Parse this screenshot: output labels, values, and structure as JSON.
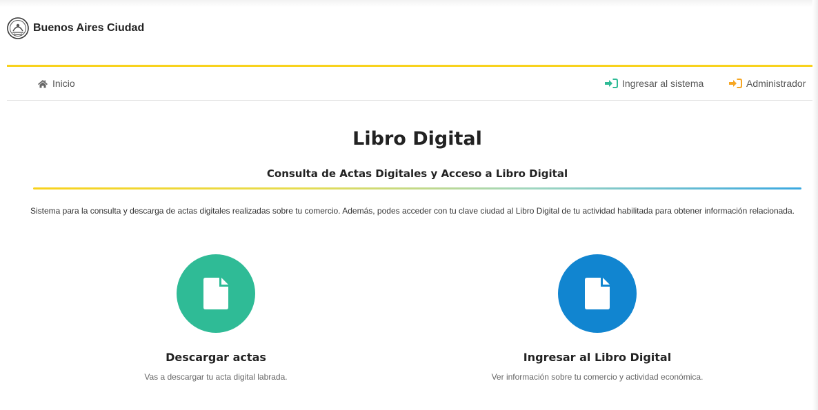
{
  "brand": {
    "name": "Buenos Aires Ciudad",
    "logo_icon": "city-seal-icon",
    "accent_color": "#f8d21c"
  },
  "nav": {
    "home": {
      "label": "Inicio",
      "icon": "home-icon"
    },
    "login": {
      "label": "Ingresar al sistema",
      "icon": "sign-in-icon",
      "icon_color": "#2fbb96"
    },
    "admin": {
      "label": "Administrador",
      "icon": "sign-in-icon",
      "icon_color": "#f6a623"
    }
  },
  "main": {
    "title": "Libro Digital",
    "subtitle": "Consulta de Actas Digitales y Acceso a Libro Digital",
    "description": "Sistema para la consulta y descarga de actas digitales realizadas sobre tu comercio. Además, podes acceder con tu clave ciudad al Libro Digital de tu actividad habilitada para obtener información relacionada."
  },
  "cards": [
    {
      "title": "Descargar actas",
      "text": "Vas a descargar tu acta digital labrada.",
      "icon": "file-icon",
      "color": "#2fbb96"
    },
    {
      "title": "Ingresar al Libro Digital",
      "text": "Ver información sobre tu comercio y actividad económica.",
      "icon": "file-icon",
      "color": "#1185d0"
    }
  ]
}
